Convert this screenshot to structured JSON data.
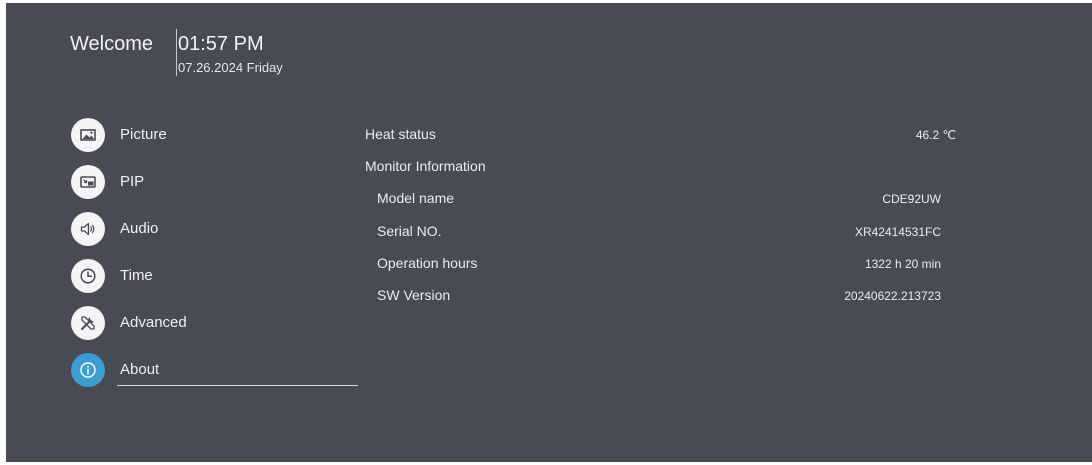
{
  "header": {
    "welcome": "Welcome",
    "time": "01:57 PM",
    "date": "07.26.2024 Friday"
  },
  "menu": {
    "items": [
      {
        "label": "Picture",
        "icon": "picture-icon"
      },
      {
        "label": "PIP",
        "icon": "pip-icon"
      },
      {
        "label": "Audio",
        "icon": "speaker-icon"
      },
      {
        "label": "Time",
        "icon": "clock-icon"
      },
      {
        "label": "Advanced",
        "icon": "tools-icon"
      },
      {
        "label": "About",
        "icon": "info-icon",
        "selected": true
      }
    ]
  },
  "about": {
    "heat_status": {
      "label": "Heat status",
      "value": "46.2 ℃"
    },
    "monitor_info_label": "Monitor Information",
    "model_name": {
      "label": "Model name",
      "value": "CDE92UW"
    },
    "serial": {
      "label": "Serial NO.",
      "value": "XR42414531FC"
    },
    "operation_hours": {
      "label": "Operation hours",
      "value": "1322 h 20 min"
    },
    "sw_version": {
      "label": "SW Version",
      "value": "20240622.213723"
    }
  },
  "colors": {
    "background": "#484a54",
    "accent": "#3c9ed1",
    "icon_circle": "#f4f4f6",
    "text": "#ececee"
  }
}
